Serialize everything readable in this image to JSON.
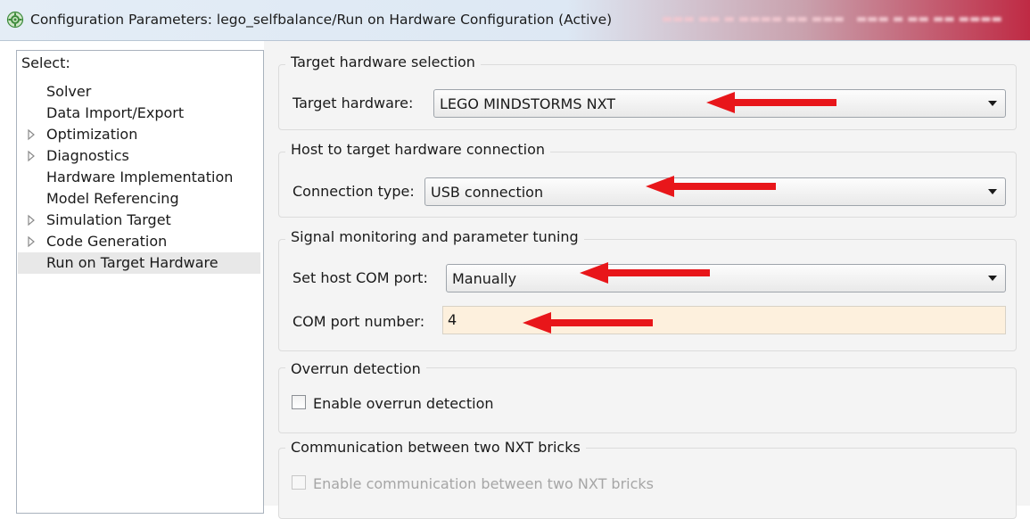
{
  "window": {
    "title": "Configuration Parameters: lego_selfbalance/Run on Hardware Configuration (Active)",
    "title_icon": "gear-cog-icon"
  },
  "left_panel": {
    "select_label": "Select:",
    "items": [
      {
        "label": "Solver",
        "expandable": false
      },
      {
        "label": "Data Import/Export",
        "expandable": false
      },
      {
        "label": "Optimization",
        "expandable": true
      },
      {
        "label": "Diagnostics",
        "expandable": true
      },
      {
        "label": "Hardware Implementation",
        "expandable": false
      },
      {
        "label": "Model Referencing",
        "expandable": false
      },
      {
        "label": "Simulation Target",
        "expandable": true
      },
      {
        "label": "Code Generation",
        "expandable": true
      },
      {
        "label": "Run on Target Hardware",
        "expandable": false,
        "selected": true
      }
    ]
  },
  "groups": {
    "target_hardware": {
      "title": "Target hardware selection",
      "label": "Target hardware:",
      "value": "LEGO MINDSTORMS NXT"
    },
    "host_connection": {
      "title": "Host to target hardware connection",
      "label": "Connection type:",
      "value": "USB connection"
    },
    "signal_monitoring": {
      "title": "Signal monitoring and parameter tuning",
      "com_port_label": "Set host COM port:",
      "com_port_value": "Manually",
      "com_number_label": "COM port number:",
      "com_number_value": "4"
    },
    "overrun": {
      "title": "Overrun detection",
      "checkbox_label": "Enable overrun detection",
      "checked": false
    },
    "communication": {
      "title": "Communication between two NXT bricks",
      "checkbox_label": "Enable communication between two NXT bricks",
      "checked": false,
      "enabled": false
    }
  },
  "colors": {
    "annotation_arrow": "#e8161a",
    "input_background": "#fdf0dd",
    "panel_background": "#f4f4f4"
  }
}
